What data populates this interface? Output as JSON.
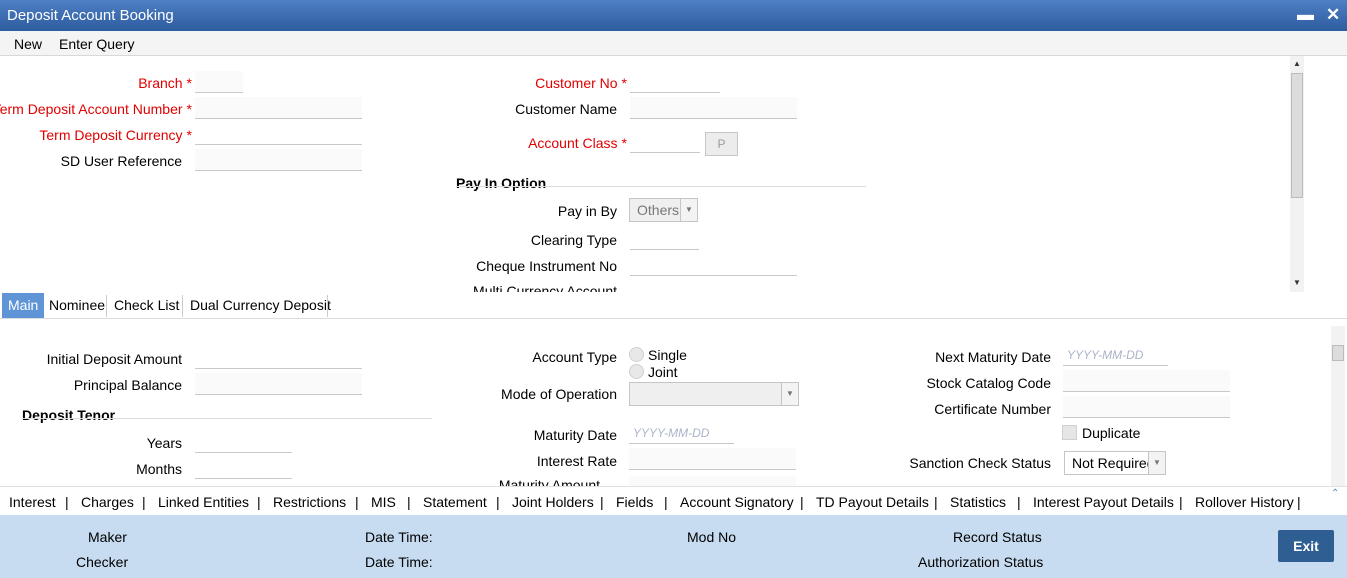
{
  "window": {
    "title": "Deposit Account Booking",
    "minimize_icon": "minimize-icon",
    "close_icon": "close-icon"
  },
  "menu": {
    "new": "New",
    "enter_query": "Enter Query"
  },
  "header_left": {
    "branch": "Branch",
    "td_account_number": "Term Deposit Account Number",
    "td_currency": "Term Deposit Currency",
    "sd_user_reference": "SD User Reference"
  },
  "header_right": {
    "customer_no": "Customer No",
    "customer_name": "Customer Name",
    "account_class": "Account Class",
    "lov_button": "P"
  },
  "pay_in": {
    "section": "Pay In Option",
    "pay_in_by": "Pay in By",
    "pay_in_by_value": "Others",
    "clearing_type": "Clearing Type",
    "cheque_instrument_no": "Cheque Instrument No",
    "multi_currency_account": "Multi Currency Account"
  },
  "required_mark": "*",
  "tabs": [
    "Main",
    "Nominee",
    "Check List",
    "Dual Currency Deposit"
  ],
  "main": {
    "initial_deposit_amount": "Initial Deposit Amount",
    "principal_balance": "Principal Balance",
    "deposit_tenor": "Deposit Tenor",
    "years": "Years",
    "months": "Months",
    "account_type": "Account Type",
    "single": "Single",
    "joint": "Joint",
    "mode_of_operation": "Mode of Operation",
    "maturity_date": "Maturity Date",
    "interest_rate": "Interest Rate",
    "maturity_amount": "Maturity Amount",
    "next_maturity_date": "Next Maturity Date",
    "stock_catalog_code": "Stock Catalog Code",
    "certificate_number": "Certificate Number",
    "duplicate": "Duplicate",
    "sanction_check_status": "Sanction Check Status",
    "sanction_check_value": "Not Required",
    "date_placeholder": "YYYY-MM-DD"
  },
  "links": [
    "Interest",
    "Charges",
    "Linked Entities",
    "Restrictions",
    "MIS",
    "Statement",
    "Joint Holders",
    "Fields",
    "Account Signatory",
    "TD Payout Details",
    "Statistics",
    "Interest Payout Details",
    "Rollover History"
  ],
  "link_separator": "|",
  "footer": {
    "maker": "Maker",
    "checker": "Checker",
    "date_time": "Date Time:",
    "mod_no": "Mod No",
    "record_status": "Record Status",
    "authorization_status": "Authorization Status",
    "exit": "Exit"
  }
}
